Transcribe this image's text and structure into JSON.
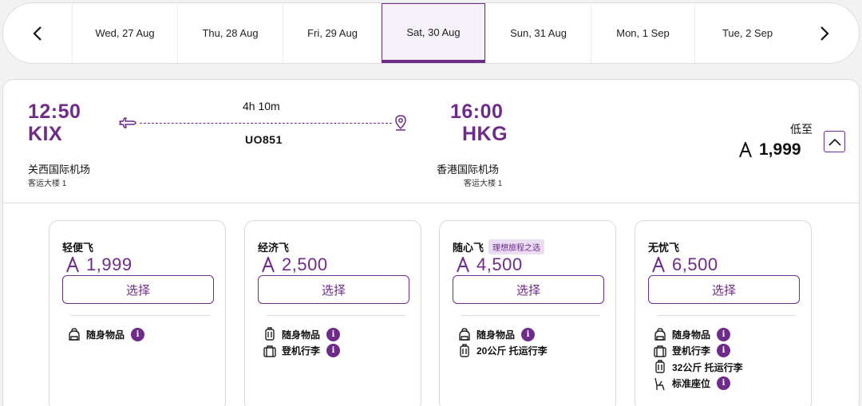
{
  "currency_symbol": "₳",
  "dates": [
    {
      "label": "Wed, 27 Aug",
      "active": false
    },
    {
      "label": "Thu, 28 Aug",
      "active": false
    },
    {
      "label": "Fri, 29 Aug",
      "active": false
    },
    {
      "label": "Sat, 30 Aug",
      "active": true
    },
    {
      "label": "Sun, 31 Aug",
      "active": false
    },
    {
      "label": "Mon, 1 Sep",
      "active": false
    },
    {
      "label": "Tue, 2 Sep",
      "active": false
    }
  ],
  "flight": {
    "departure": {
      "time": "12:50",
      "code": "KIX",
      "airport": "关西国际机场",
      "terminal": "客运大楼 1"
    },
    "arrival": {
      "time": "16:00",
      "code": "HKG",
      "airport": "香港国际机场",
      "terminal": "客运大楼 1"
    },
    "duration": "4h 10m",
    "flight_number": "UO851",
    "from_label": "低至",
    "lowest_price": "1,999"
  },
  "fares": [
    {
      "name": "轻便飞",
      "badge": "",
      "price": "1,999",
      "select_label": "选择",
      "features": [
        {
          "icon": "bag-icon",
          "label": "随身物品",
          "info": true
        }
      ]
    },
    {
      "name": "经济飞",
      "badge": "",
      "price": "2,500",
      "select_label": "选择",
      "features": [
        {
          "icon": "luggage-icon",
          "label": "随身物品",
          "info": true
        },
        {
          "icon": "briefcase-icon",
          "label": "登机行李",
          "info": true
        }
      ]
    },
    {
      "name": "随心飞",
      "badge": "理想旅程之选",
      "price": "4,500",
      "select_label": "选择",
      "features": [
        {
          "icon": "bag-icon",
          "label": "随身物品",
          "info": true
        },
        {
          "icon": "luggage-icon",
          "label": "20公斤 托运行李",
          "info": false
        }
      ]
    },
    {
      "name": "无忧飞",
      "badge": "",
      "price": "6,500",
      "select_label": "选择",
      "features": [
        {
          "icon": "bag-icon",
          "label": "随身物品",
          "info": true
        },
        {
          "icon": "briefcase-icon",
          "label": "登机行李",
          "info": true
        },
        {
          "icon": "luggage-icon",
          "label": "32公斤 托运行李",
          "info": false
        },
        {
          "icon": "seat-icon",
          "label": "标准座位",
          "info": true
        }
      ]
    }
  ],
  "colors": {
    "accent": "#6e2b8a",
    "badge_bg": "#eadcf2"
  }
}
